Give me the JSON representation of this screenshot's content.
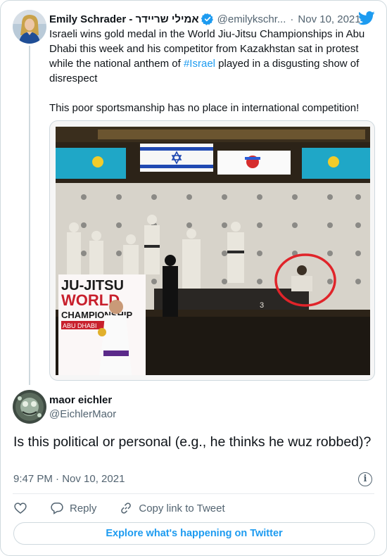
{
  "parent_tweet": {
    "author_name": "Emily Schrader - אמילי שריידר",
    "handle": "@emilykschr...",
    "separator": "·",
    "date": "Nov 10, 2021",
    "text_before_hashtag": "Israeli wins gold medal in the World Jiu-Jitsu Championships in Abu Dhabi this week and his competitor from Kazakhstan sat in protest while the national anthem of ",
    "hashtag": "#Israel",
    "text_after_hashtag": " played in a disgusting show of disrespect",
    "text_paragraph_2": "This poor sportsmanship has no place in international competition!",
    "image": {
      "banner_line1": "JU-JITSU",
      "banner_line2": "WORLD",
      "banner_line3": "CHAMPIONSHIP",
      "banner_line4": "ABU DHABI",
      "podium_number": "3"
    }
  },
  "reply_tweet": {
    "author_name": "maor eichler",
    "handle": "@EichlerMaor",
    "text": "Is this political or personal (e.g., he thinks he wuz robbed)?",
    "timestamp": "9:47 PM · Nov 10, 2021"
  },
  "actions": {
    "reply_label": "Reply",
    "copy_link_label": "Copy link to Tweet"
  },
  "explore_label": "Explore what's happening on Twitter",
  "colors": {
    "twitter_blue": "#1d9bf0",
    "text_primary": "#0f1419",
    "text_secondary": "#536471",
    "border": "#cfd9de",
    "circle_annotation": "#e0242a"
  }
}
